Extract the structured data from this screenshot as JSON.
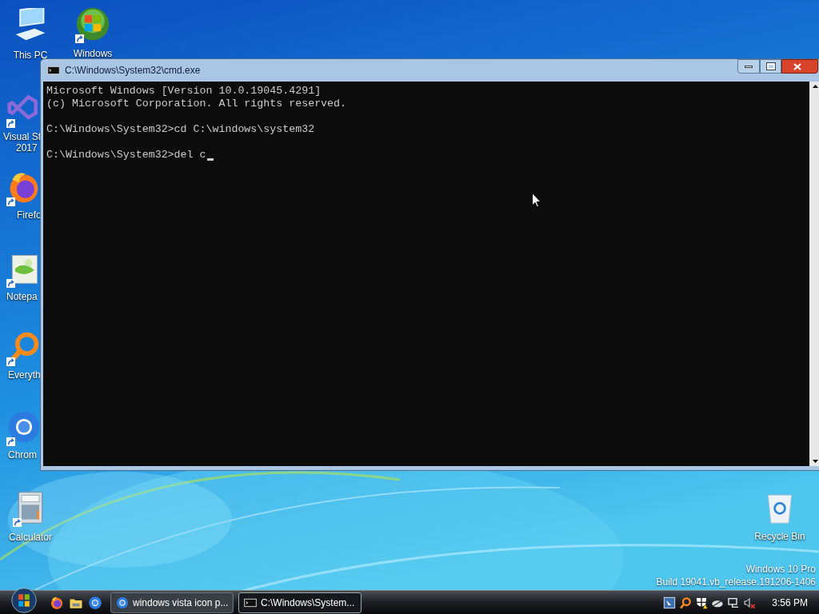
{
  "desktop_icons": [
    {
      "kind": "computer",
      "labels": [
        "This PC"
      ],
      "shortcut": false
    },
    {
      "kind": "windows",
      "labels": [
        "Windows"
      ],
      "shortcut": true
    },
    {
      "kind": "studio",
      "labels": [
        "Visual St",
        "2017"
      ],
      "shortcut": true
    },
    {
      "kind": "firefox",
      "labels": [
        "Firefo"
      ],
      "shortcut": true
    },
    {
      "kind": "notepad",
      "labels": [
        "Notepa"
      ],
      "shortcut": true
    },
    {
      "kind": "everything",
      "labels": [
        "Everyth"
      ],
      "shortcut": true
    },
    {
      "kind": "chrome",
      "labels": [
        "Chrom"
      ],
      "shortcut": true
    },
    {
      "kind": "calculator",
      "labels": [
        "Calculator"
      ],
      "shortcut": true
    },
    {
      "kind": "recycle",
      "labels": [
        "Recycle Bin"
      ],
      "shortcut": false
    }
  ],
  "window": {
    "title": "C:\\Windows\\System32\\cmd.exe",
    "console": {
      "blocks": [
        [
          "Microsoft Windows [Version 10.0.19045.4291]",
          "(c) Microsoft Corporation. All rights reserved."
        ],
        [
          "C:\\Windows\\System32>cd C:\\windows\\system32"
        ],
        [
          "C:\\Windows\\System32>del c"
        ]
      ],
      "cursor": true
    }
  },
  "watermark": [
    "Windows 10 Pro",
    "Build 19041.vb_release.191206-1406"
  ],
  "taskbar": {
    "quick_launch": [
      {
        "kind": "firefox"
      },
      {
        "kind": "folder"
      },
      {
        "kind": "chrome"
      }
    ],
    "tasks": [
      {
        "kind": "chrome",
        "label": "windows vista icon p...",
        "selected": false
      },
      {
        "kind": "cmd",
        "label": "C:\\Windows\\System...",
        "selected": true
      }
    ],
    "tray": [
      {
        "kind": "app"
      },
      {
        "kind": "search"
      },
      {
        "kind": "shield"
      },
      {
        "kind": "cloud"
      },
      {
        "kind": "network"
      },
      {
        "kind": "volume-muted"
      }
    ],
    "clock": "3:56 PM"
  }
}
